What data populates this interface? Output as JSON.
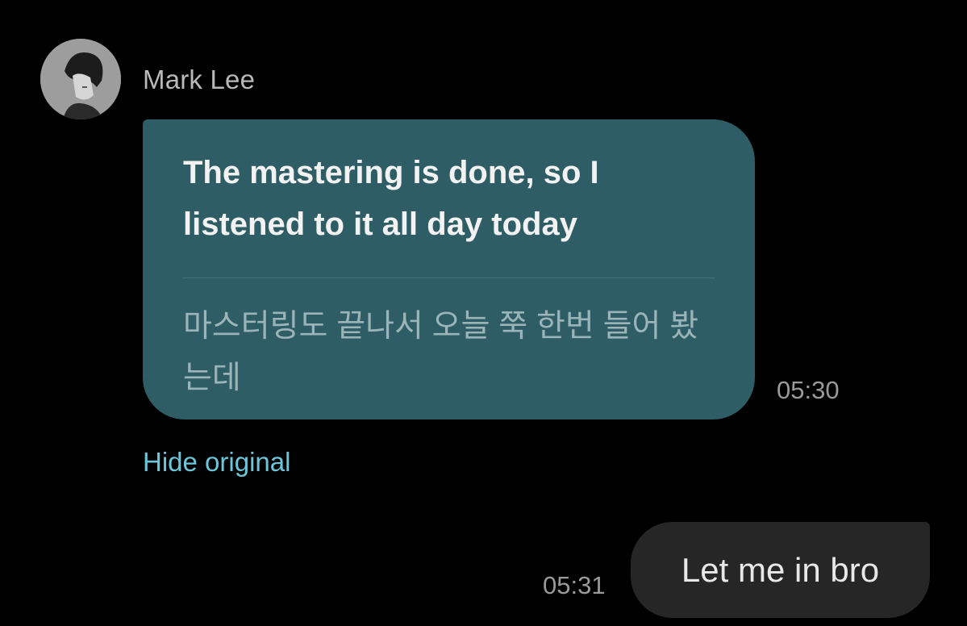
{
  "sender": {
    "name": "Mark Lee",
    "avatar_icon": "profile-photo"
  },
  "incoming": {
    "translated": "The mastering is done, so I listened to it all day today",
    "original": "마스터링도 끝나서 오늘 쭉 한번 들어 봤는데",
    "time": "05:30",
    "hide_original_label": "Hide original"
  },
  "outgoing": {
    "text": "Let me in bro",
    "time": "05:31"
  },
  "colors": {
    "background": "#000000",
    "incoming_bubble": "#2e5d66",
    "outgoing_bubble": "#262626",
    "link": "#6cc6da"
  }
}
